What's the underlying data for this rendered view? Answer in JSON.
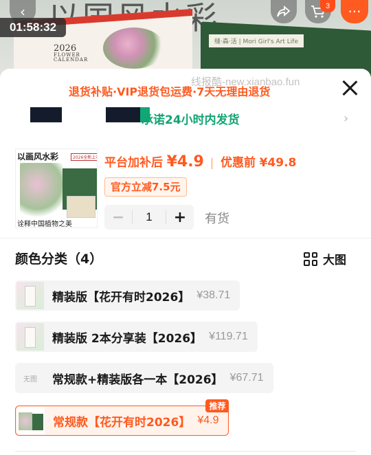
{
  "header": {
    "timer": "01:58:32",
    "cart_count": "3"
  },
  "backdrop": {
    "calendar_year": "2026",
    "calendar_line1": "FLOWER",
    "calendar_line2": "CALENDAR",
    "book_label": "缝·森·活 | Mori Girl's Art Life"
  },
  "sheet": {
    "promo": "退货补贴·VIP退货包运费·7天无理由退货",
    "watermark": "线报酷-new.xianbao.fun",
    "shipping": "承诺24小时内发货"
  },
  "product": {
    "thumb_title": "以画风水彩",
    "thumb_tag": "2026全新上市",
    "thumb_bottom": "诠释中国植物之美",
    "price_label": "平台加补后",
    "price": "¥4.9",
    "pre_label": "优惠前",
    "pre_price": "¥49.8",
    "discount": "官方立减7.5元",
    "quantity": "1",
    "stock": "有货"
  },
  "variants": {
    "title": "颜色分类（4）",
    "big_view": "大图",
    "no_image": "无图",
    "recommend": "推荐",
    "items": [
      {
        "name": "精装版【花开有时2026】",
        "price": "¥38.71"
      },
      {
        "name": "精装版 2本分享装【2026】",
        "price": "¥119.71"
      },
      {
        "name": "常规款+精装版各一本【2026】",
        "price": "¥67.71"
      },
      {
        "name": "常规款【花开有时2026】",
        "price": "¥4.9"
      }
    ]
  },
  "colors": {
    "accent": "#ff5a1f",
    "shipping_green": "#12a472"
  }
}
